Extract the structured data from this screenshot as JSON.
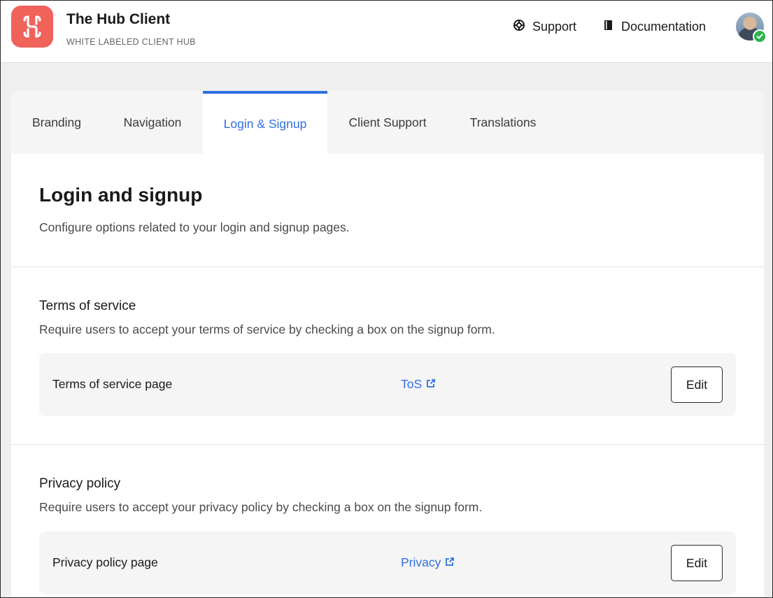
{
  "app": {
    "title": "The Hub Client",
    "subtitle": "WHITE LABELED CLIENT HUB",
    "logo_icon": "hub-logo-icon",
    "brand_color": "#f0625a"
  },
  "header": {
    "support_label": "Support",
    "support_icon": "lifebuoy-icon",
    "docs_label": "Documentation",
    "docs_icon": "book-icon",
    "avatar_status": "online",
    "status_color": "#2db24a"
  },
  "tabs": [
    {
      "label": "Branding",
      "active": false
    },
    {
      "label": "Navigation",
      "active": false
    },
    {
      "label": "Login & Signup",
      "active": true
    },
    {
      "label": "Client Support",
      "active": false
    },
    {
      "label": "Translations",
      "active": false
    }
  ],
  "accent_color": "#2f6fe0",
  "main": {
    "title": "Login and signup",
    "description": "Configure options related to your login and signup pages."
  },
  "sections": [
    {
      "title": "Terms of service",
      "description": "Require users to accept your terms of service by checking a box on the signup form.",
      "row_label": "Terms of service page",
      "link_text": "ToS",
      "link_icon": "external-link-icon",
      "button_label": "Edit"
    },
    {
      "title": "Privacy policy",
      "description": "Require users to accept your privacy policy by checking a box on the signup form.",
      "row_label": "Privacy policy page",
      "link_text": "Privacy",
      "link_icon": "external-link-icon",
      "button_label": "Edit"
    }
  ]
}
